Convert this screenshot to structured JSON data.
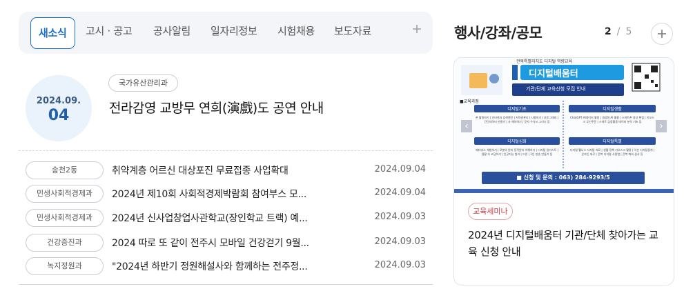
{
  "tabs": [
    {
      "label": "새소식",
      "active": true
    },
    {
      "label": "고시 · 공고"
    },
    {
      "label": "공사알림"
    },
    {
      "label": "일자리정보"
    },
    {
      "label": "시험채용"
    },
    {
      "label": "보도자료"
    }
  ],
  "tabs_more_icon": "plus-icon",
  "featured": {
    "year_month": "2024.09.",
    "day": "04",
    "department": "국가유산관리과",
    "title": "전라감영 교방무 연희(演戲)도 공연 안내"
  },
  "news": [
    {
      "department": "송천2동",
      "title": "취약계층 어르신 대상포진 무료접종 사업확대",
      "date": "2024.09.04"
    },
    {
      "department": "민생사회적경제과",
      "title": "2024년 제10회 사회적경제박람회 참여부스 모...",
      "date": "2024.09.04"
    },
    {
      "department": "민생사회적경제과",
      "title": "2024년 신사업창업사관학교(장인학교 트랙) 예...",
      "date": "2024.09.03"
    },
    {
      "department": "건강증진과",
      "title": "2024 따로 또 같이 전주시 모바일 건강걷기 9월...",
      "date": "2024.09.03"
    },
    {
      "department": "녹지정원과",
      "title": "\"2024년 하반기 정원해설사와 함께하는 전주정...",
      "date": "2024.09.03"
    }
  ],
  "events": {
    "title": "행사/강좌/공모",
    "page_current": "2",
    "page_separator": "/",
    "page_total": "5",
    "prev_icon": "chevron-left-icon",
    "next_icon": "chevron-right-icon",
    "plus_icon": "plus-icon",
    "card": {
      "category": "교육세미나",
      "title": "2024년 디지털배움터 기관/단체 찾아가는 교육 신청 안내",
      "poster": {
        "header": "전북특별자치도 디지털 역량교육",
        "brand": "디지털배움터",
        "subtitle": "기관/단체 교육신청 모집 안내",
        "section": "■교육과정",
        "course_1": "디지털기초",
        "course_2": "디지털생활",
        "course_3": "디지털심화",
        "course_4": "디지털특별",
        "desc_1": "폰 활용하기 | 인터넷과 검색엔진 | 저작권관리 | 사용하기 | 포토그래피 | 간단데이터 만들기 | 사 해야하기 | 문자 수식쓰 그리기 등",
        "desc_2": "ChatGPT AI데이터 활용 | 생성형 AI 활용 | 스마트폰 영상 편집 | 키오스크 무인주문 | 스마트 금융활용 데이터 분석 기초 등",
        "desc_3": "메타버스 체험하기 | 로봇의 원리 동작원리 이해하기 | 디지털 일러스트 | 생활 속 코딩하기 | 인공지능 원리 | 드론 | 1인 방송 만들기 등",
        "desc_4": "디지털 웰니스 디지털 치료 | 생활 정책 키오스크 활용 | 익산 디지털중개 | 온라인 세무 | 전북 디지털 사용법 | 전북 에버 심사 등",
        "contact": "■ 신청 및 문의 : 063) 284-9293/5"
      }
    }
  },
  "colors": {
    "accent": "#1f6fc7",
    "tab_bar_bg": "#f3f5f8",
    "date_circle_bg": "#eaf2fb",
    "category_red": "#d13c45",
    "poster_blue": "#3d64b1"
  }
}
